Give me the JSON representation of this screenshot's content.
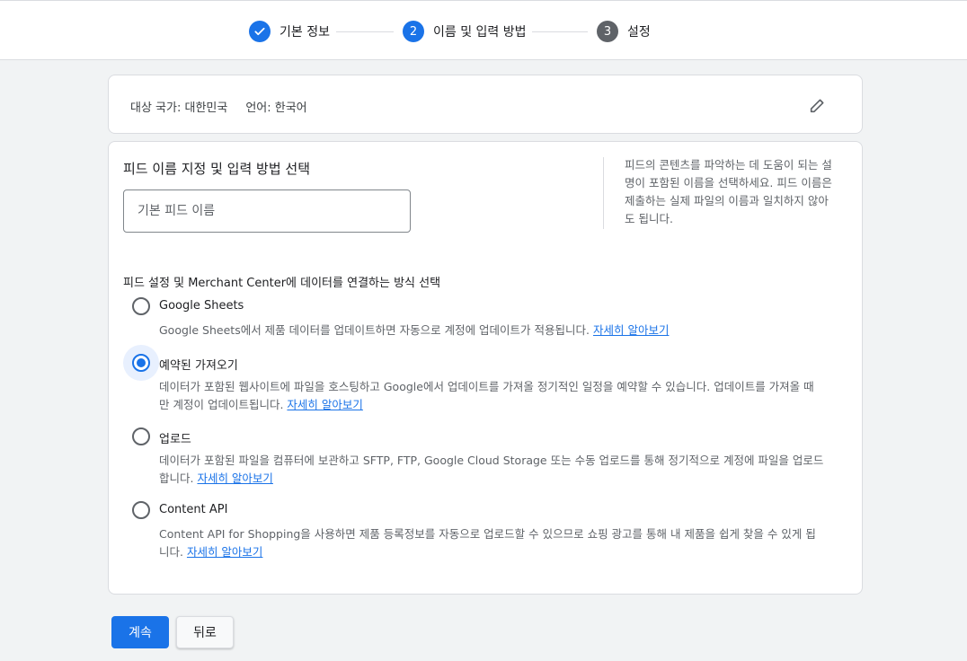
{
  "stepper": {
    "steps": [
      {
        "number": "",
        "label": "기본 정보",
        "state": "done",
        "icon": "check-icon"
      },
      {
        "number": "2",
        "label": "이름 및 입력 방법",
        "state": "active"
      },
      {
        "number": "3",
        "label": "설정",
        "state": "pending"
      }
    ]
  },
  "summary": {
    "country_label": "대상 국가: 대한민국",
    "language_label": "언어: 한국어",
    "edit_icon": "pencil-icon"
  },
  "name_section": {
    "title": "피드 이름 지정 및 입력 방법 선택",
    "input_placeholder": "기본 피드 이름",
    "input_value": "",
    "help_text": "피드의 콘텐츠를 파악하는 데 도움이 되는 설명이 포함된 이름을 선택하세요. 피드 이름은 제출하는 실제 파일의 이름과 일치하지 않아도 됩니다."
  },
  "method_section": {
    "title": "피드 설정 및 Merchant Center에 데이터를 연결하는 방식 선택",
    "options": [
      {
        "title": "Google Sheets",
        "description": "Google Sheets에서 제품 데이터를 업데이트하면 자동으로 계정에 업데이트가 적용됩니다. ",
        "link": "자세히 알아보기",
        "selected": false
      },
      {
        "title": "예약된 가져오기",
        "description": "데이터가 포함된 웹사이트에 파일을 호스팅하고 Google에서 업데이트를 가져올 정기적인 일정을 예약할 수 있습니다. 업데이트를 가져올 때만 계정이 업데이트됩니다. ",
        "link": "자세히 알아보기",
        "selected": true
      },
      {
        "title": "업로드",
        "description": "데이터가 포함된 파일을 컴퓨터에 보관하고 SFTP, FTP, Google Cloud Storage 또는 수동 업로드를 통해 정기적으로 계정에 파일을 업로드합니다. ",
        "link": "자세히 알아보기",
        "selected": false
      },
      {
        "title": "Content API",
        "description": "Content API for Shopping을 사용하면 제품 등록정보를 자동으로 업로드할 수 있으므로 쇼핑 광고를 통해 내 제품을 쉽게 찾을 수 있게 됩니다. ",
        "link": "자세히 알아보기",
        "selected": false
      }
    ]
  },
  "footer": {
    "continue_label": "계속",
    "back_label": "뒤로"
  },
  "colors": {
    "accent": "#1a73e8",
    "pending_step": "#5f6368",
    "background": "#f1f3f4"
  }
}
